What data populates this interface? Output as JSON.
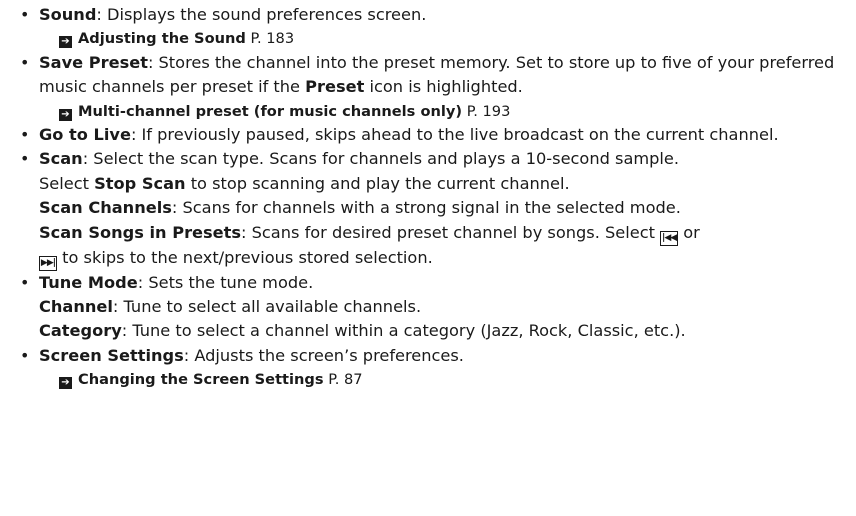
{
  "bullet_glyph": "•",
  "xref_glyph": "➔",
  "items": [
    {
      "term": "Sound",
      "text": ": Displays the sound preferences screen.",
      "xref": {
        "title": "Adjusting the Sound",
        "page": "P. 183"
      }
    },
    {
      "term": "Save Preset",
      "text_before": ": Stores the channel into the preset memory. Set to store up to five of your preferred music channels per preset if the ",
      "bold_inline": "Preset",
      "text_after": " icon is highlighted.",
      "xref": {
        "title": "Multi-channel preset (for music channels only)",
        "page": "P. 193"
      }
    },
    {
      "term": "Go to Live",
      "text": ": If previously paused, skips ahead to the live broadcast on the current channel."
    },
    {
      "term": "Scan",
      "text": ": Select the scan type. Scans for channels and plays a 10-second sample.",
      "line2_before": "Select ",
      "line2_bold": "Stop Scan",
      "line2_after": " to stop scanning and play the current channel.",
      "sub1_term": "Scan Channels",
      "sub1_text": ": Scans for channels with a strong signal in the selected mode.",
      "sub2_term": "Scan Songs in Presets",
      "sub2_text": ": Scans for desired preset channel by songs. Select ",
      "sub2_or": " or",
      "sub2_end": " to skips to the next/previous stored selection.",
      "icon_prev": "skip-back-icon",
      "icon_next": "skip-forward-icon"
    },
    {
      "term": "Tune Mode",
      "text": ": Sets the tune mode.",
      "sub1_term": "Channel",
      "sub1_text": ": Tune to select all available channels.",
      "sub2_term": "Category",
      "sub2_text": ": Tune to select a channel within a category (Jazz, Rock, Classic, etc.)."
    },
    {
      "term": "Screen Settings",
      "text": ": Adjusts the screen’s preferences.",
      "xref": {
        "title": "Changing the Screen Settings",
        "page": "P. 87"
      }
    }
  ]
}
